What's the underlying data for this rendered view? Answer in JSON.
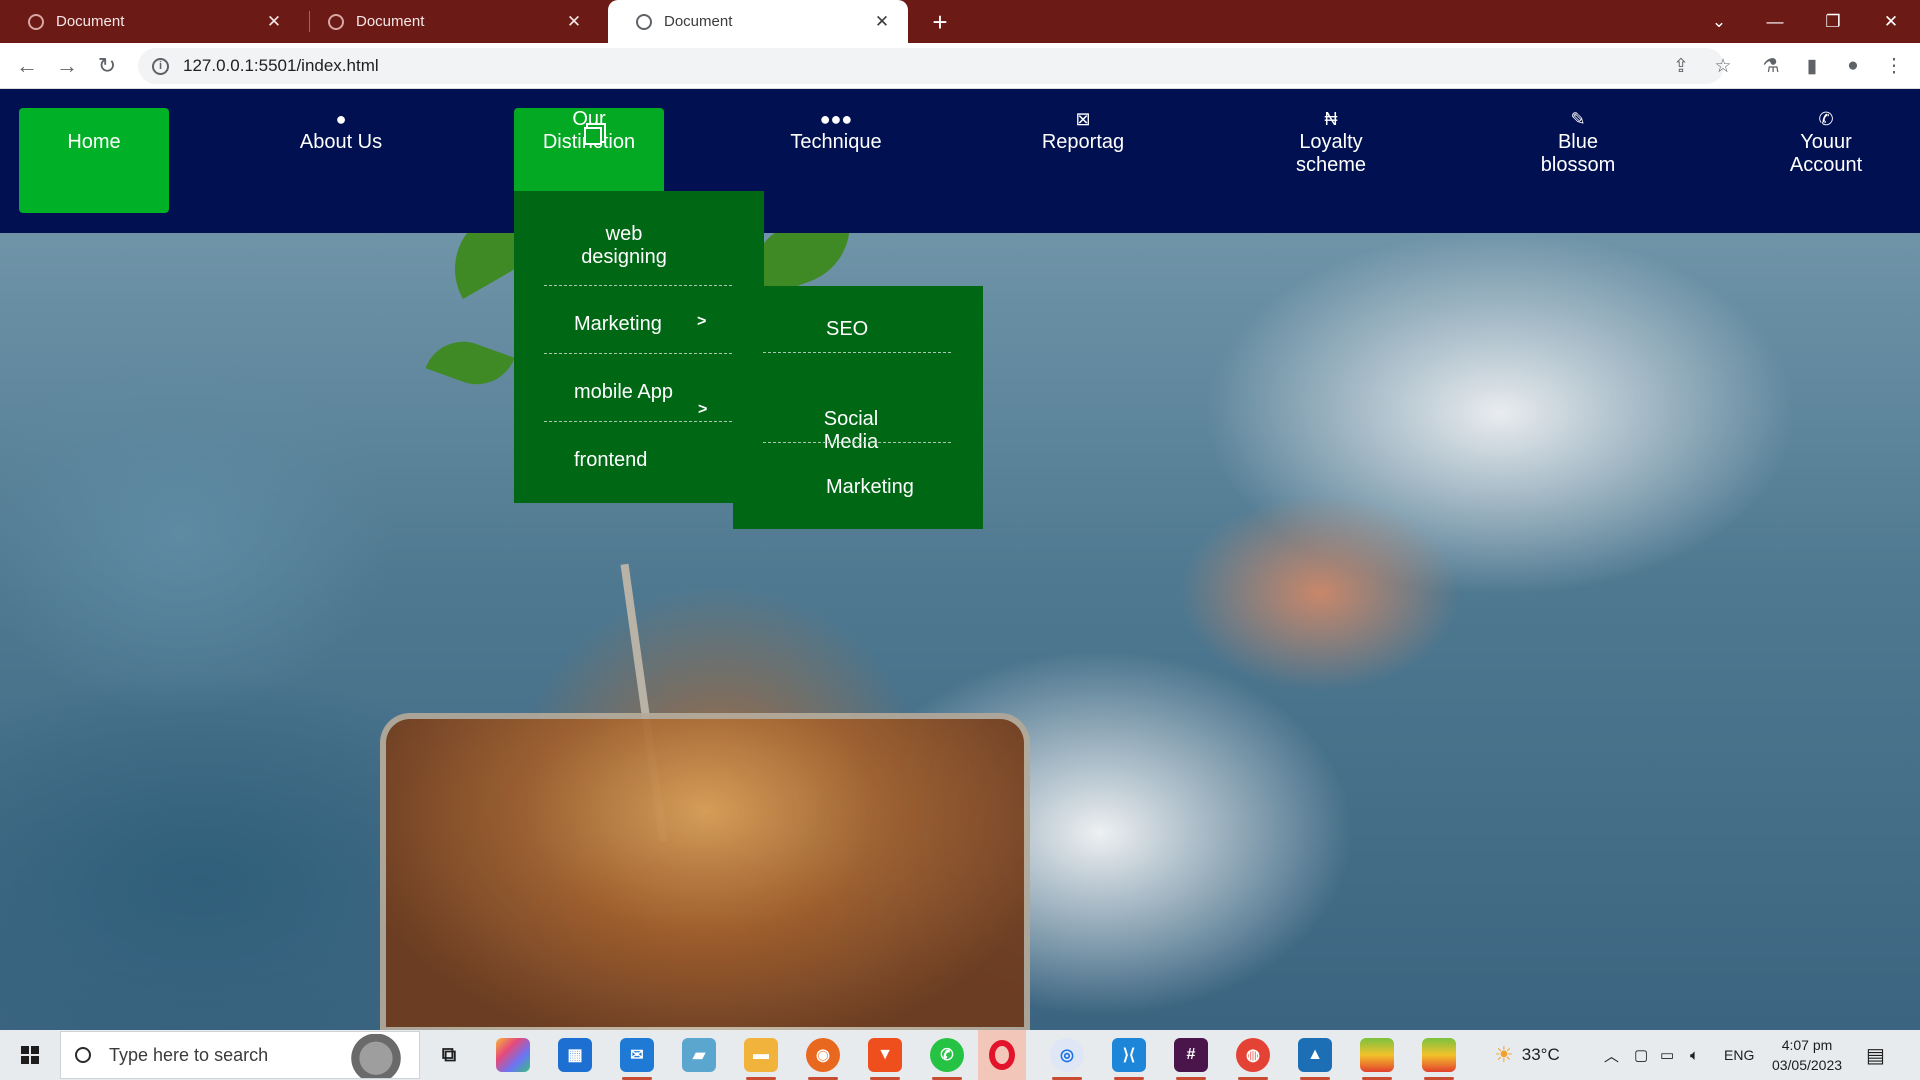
{
  "browser": {
    "tabs": [
      {
        "title": "Document"
      },
      {
        "title": "Document"
      },
      {
        "title": "Document"
      }
    ],
    "url": "127.0.0.1:5501/index.html"
  },
  "nav": {
    "items": [
      {
        "label": "Home",
        "icon": "home"
      },
      {
        "label": "About Us",
        "icon": "user-icon"
      },
      {
        "label": "Our\nDistinction",
        "icon": "clone-icon"
      },
      {
        "label": "Technique",
        "icon": "users-icon"
      },
      {
        "label": "Reportag",
        "icon": "file-excel-icon"
      },
      {
        "label": "Loyalty\nscheme",
        "icon": "naira-icon"
      },
      {
        "label": "Blue\nblossom",
        "icon": "edit-icon"
      },
      {
        "label": "Youur\nAccount",
        "icon": "phone-icon"
      }
    ],
    "colors": {
      "navbar": "#011050",
      "active": "#03a823",
      "home": "#00b026",
      "dropdown": "#006815"
    }
  },
  "dropdown": {
    "items": [
      {
        "label": "web\ndesigning"
      },
      {
        "label": "Marketing"
      },
      {
        "label": "mobile App"
      },
      {
        "label": "frontend"
      }
    ]
  },
  "submenu": {
    "items": [
      {
        "label": "SEO"
      },
      {
        "label": "Social\nMedia"
      },
      {
        "label": "Marketing"
      }
    ]
  },
  "taskbar": {
    "search_placeholder": "Type here to search",
    "weather": "33°C",
    "language": "ENG",
    "time": "4:07 pm",
    "date": "03/05/2023"
  }
}
